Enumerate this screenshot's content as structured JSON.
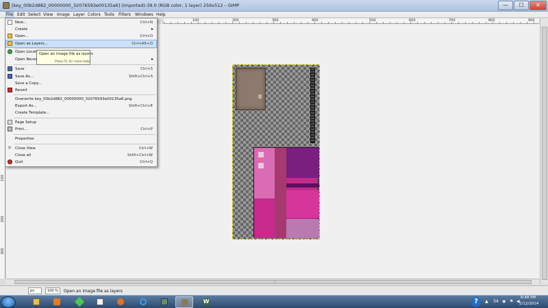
{
  "window": {
    "title": "[key_00b2d882_00000000_32076593e00135a6] (imported)-39.0 (RGB color, 1 layer) 256x512 – GIMP",
    "minimize_glyph": "—",
    "maximize_glyph": "☐",
    "close_glyph": "✕"
  },
  "menubar": [
    "File",
    "Edit",
    "Select",
    "View",
    "Image",
    "Layer",
    "Colors",
    "Tools",
    "Filters",
    "Windows",
    "Help"
  ],
  "ruler_top": [
    "100",
    "200",
    "300",
    "400",
    "500",
    "600",
    "700",
    "800",
    "900"
  ],
  "ruler_left": [
    "100",
    "200",
    "300"
  ],
  "file_menu": {
    "items": [
      {
        "label": "New...",
        "shortcut": "Ctrl+N",
        "icon": "new-icon"
      },
      {
        "label": "Create",
        "shortcut": "",
        "submenu": true,
        "icon": ""
      },
      {
        "label": "Open...",
        "shortcut": "Ctrl+O",
        "icon": "open-icon"
      },
      {
        "label": "Open as Layers...",
        "shortcut": "Ctrl+Alt+O",
        "icon": "open-layers-icon",
        "highlighted": true
      },
      {
        "label": "Open Location...",
        "shortcut": "",
        "icon": "globe-icon"
      },
      {
        "label": "Open Recent",
        "shortcut": "",
        "submenu": true,
        "icon": ""
      },
      {
        "label": "Save",
        "shortcut": "Ctrl+S",
        "icon": "save-icon"
      },
      {
        "label": "Save As...",
        "shortcut": "Shift+Ctrl+S",
        "icon": "save-as-icon"
      },
      {
        "label": "Save a Copy...",
        "shortcut": "",
        "icon": ""
      },
      {
        "label": "Revert",
        "shortcut": "",
        "icon": "revert-icon"
      },
      {
        "label": "Overwrite key_00b2d882_00000000_32076593e00135a6.png",
        "shortcut": "",
        "icon": ""
      },
      {
        "label": "Export As...",
        "shortcut": "Shift+Ctrl+E",
        "icon": ""
      },
      {
        "label": "Create Template...",
        "shortcut": "",
        "icon": ""
      },
      {
        "label": "Page Setup",
        "shortcut": "",
        "icon": "page-setup-icon"
      },
      {
        "label": "Print...",
        "shortcut": "Ctrl+P",
        "icon": "print-icon"
      },
      {
        "label": "Properties",
        "shortcut": "",
        "icon": ""
      },
      {
        "label": "Close View",
        "shortcut": "Ctrl+W",
        "icon": "close-view-icon"
      },
      {
        "label": "Close all",
        "shortcut": "Shift+Ctrl+W",
        "icon": ""
      },
      {
        "label": "Quit",
        "shortcut": "Ctrl+Q",
        "icon": "quit-icon"
      }
    ]
  },
  "tooltip": {
    "text": "Open an image file as layers",
    "hint": "Press F1 for more help"
  },
  "statusbar": {
    "unit": "px",
    "zoom": "100 %",
    "message": "Open an image file as layers"
  },
  "tray": {
    "help": "?",
    "count": "34",
    "time": "8:48 PM",
    "date": "2/12/2014"
  },
  "taskbar": {
    "active_app_label": "W"
  }
}
